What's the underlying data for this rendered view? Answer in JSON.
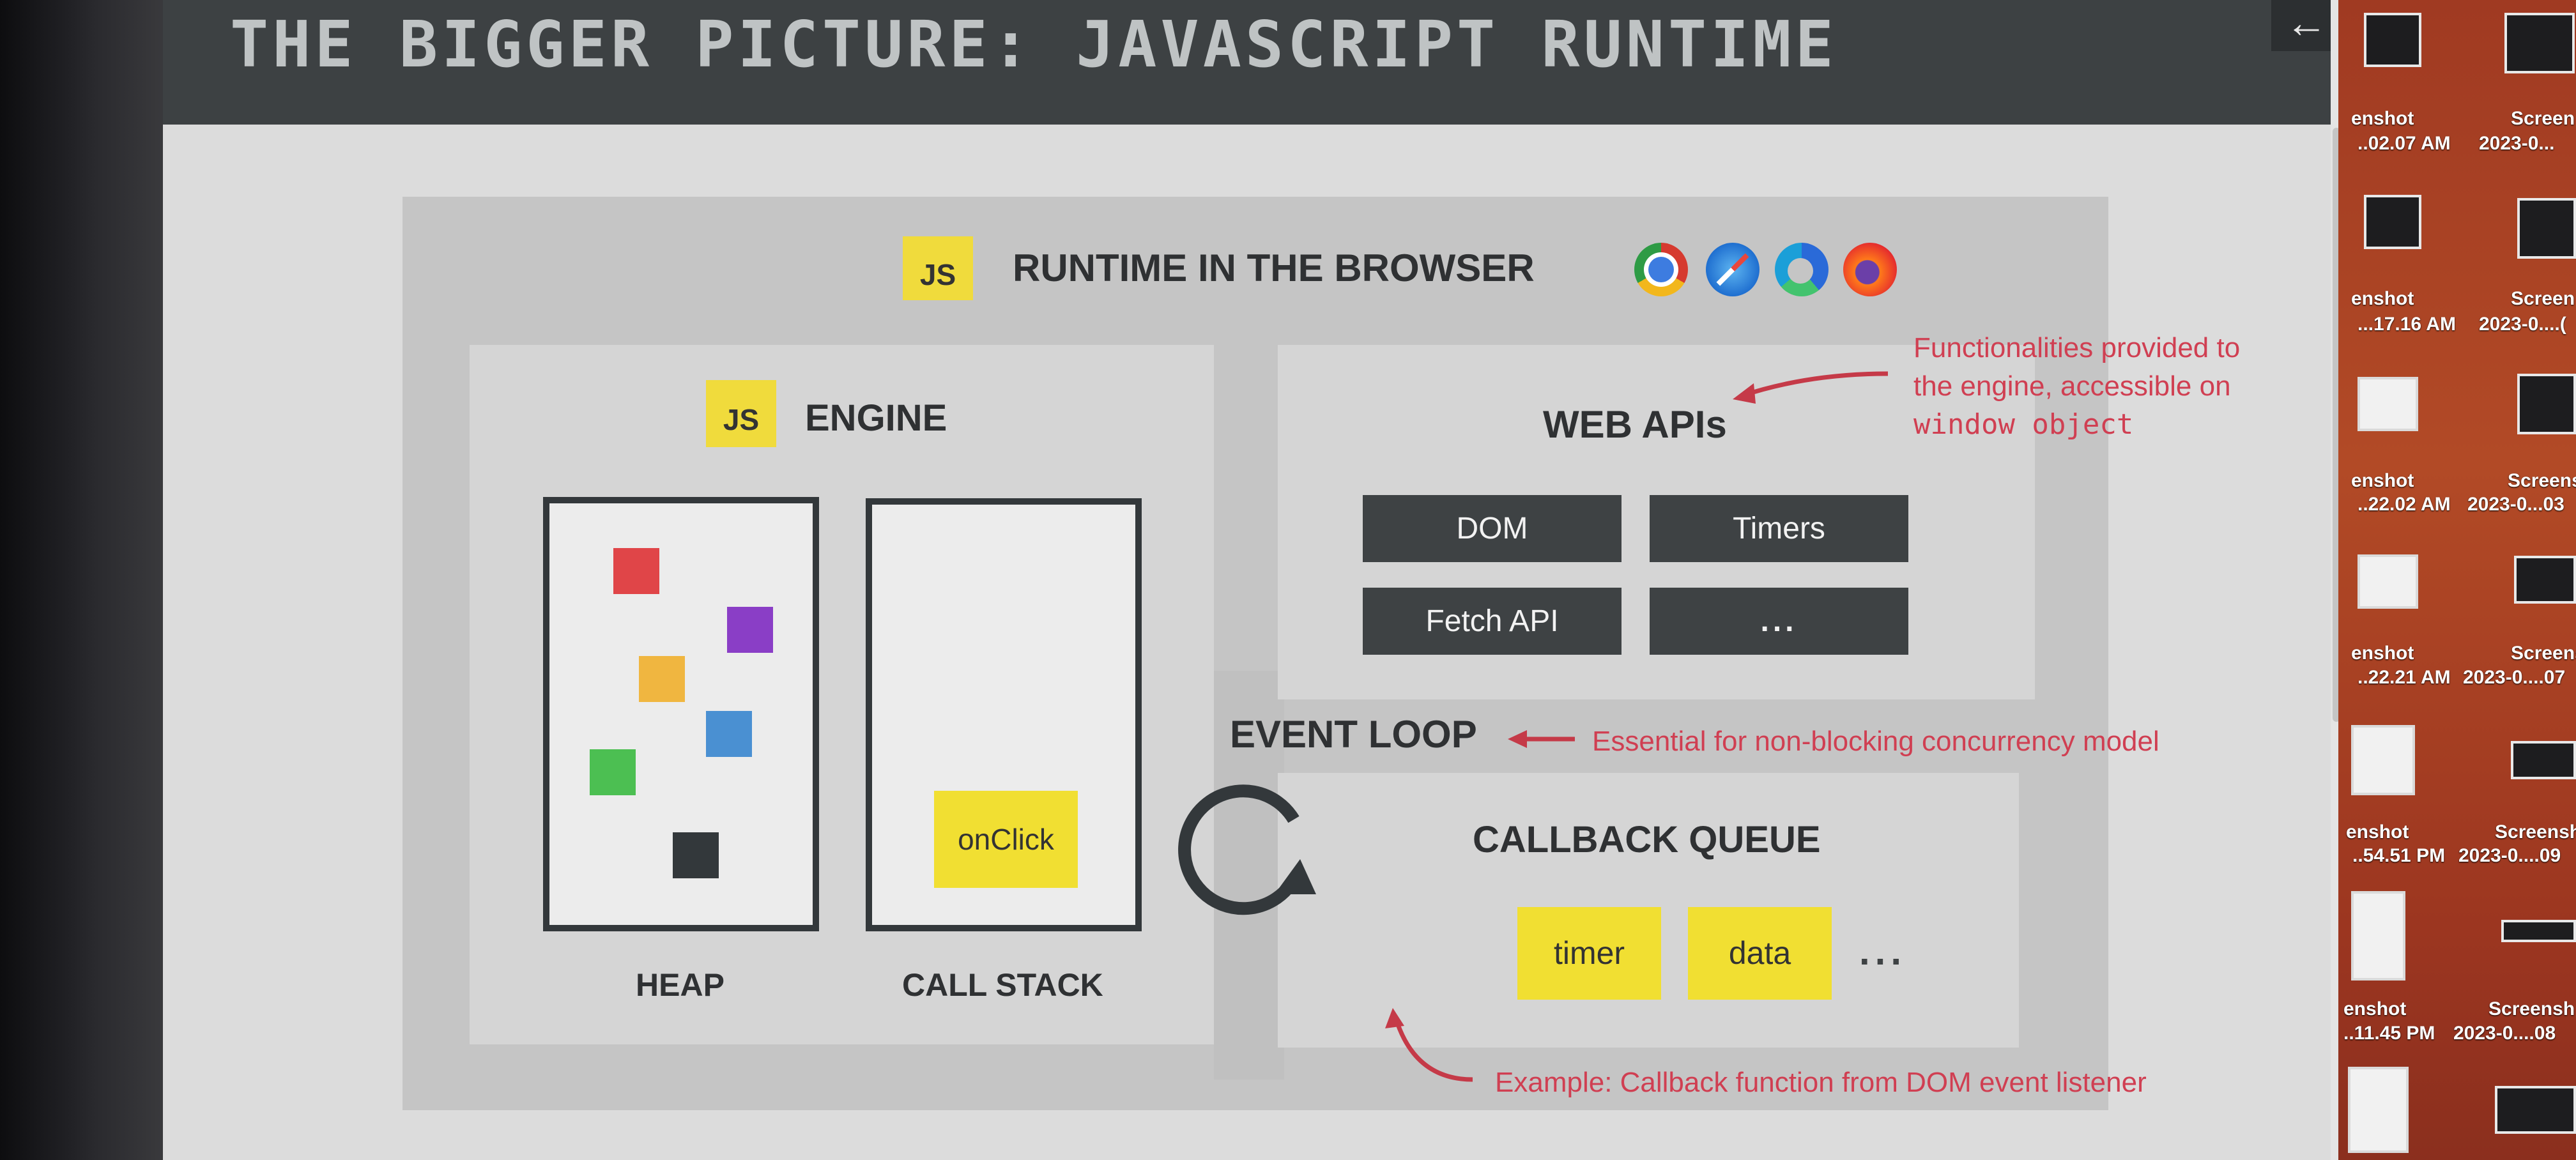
{
  "slide": {
    "title": "THE BIGGER PICTURE: JAVASCRIPT RUNTIME",
    "back_arrow": "←"
  },
  "diagram": {
    "runtime": {
      "badge": "JS",
      "title": "RUNTIME IN THE BROWSER"
    },
    "browser_icons": [
      "chrome-icon",
      "safari-icon",
      "edge-icon",
      "firefox-icon"
    ],
    "engine": {
      "badge": "JS",
      "title": "ENGINE",
      "heap_label": "HEAP",
      "call_stack_label": "CALL STACK",
      "call_stack_frame": "onClick",
      "heap_object_colors": [
        "#e04548",
        "#8a3ec6",
        "#f0b640",
        "#4a90d2",
        "#4cbf52",
        "#33383b"
      ]
    },
    "web_apis": {
      "title": "WEB APIs",
      "items": [
        "DOM",
        "Timers",
        "Fetch API",
        "..."
      ]
    },
    "event_loop": {
      "title": "EVENT LOOP"
    },
    "callback_queue": {
      "title": "CALLBACK QUEUE",
      "items": [
        "timer",
        "data"
      ],
      "more": "..."
    },
    "notes": {
      "web_apis_line1": "Functionalities provided to",
      "web_apis_line2": "the engine, accessible on",
      "web_apis_line3": "window object",
      "event_loop": "Essential for non-blocking concurrency model",
      "callback": "Example: Callback function from DOM event listener"
    },
    "colors": {
      "accent_yellow": "#f1df32",
      "dark": "#3e4244",
      "annotation_red": "#d03f52"
    }
  },
  "desktop": {
    "files": [
      {
        "col1": "enshot",
        "col2": "Screen",
        "col1b": "..02.07 AM",
        "col2b": "2023-0..."
      },
      {
        "col1": "enshot",
        "col2": "Screen",
        "col1b": "...17.16 AM",
        "col2b": "2023-0....("
      },
      {
        "col1": "enshot",
        "col2": "Screens",
        "col1b": "..22.02 AM",
        "col2b": "2023-0...03"
      },
      {
        "col1": "enshot",
        "col2": "Screens",
        "col1b": "..22.21 AM",
        "col2b": "2023-0....07"
      },
      {
        "col1": "enshot",
        "col2": "Screensh",
        "col1b": "..54.51 PM",
        "col2b": "2023-0....09"
      },
      {
        "col1": "enshot",
        "col2": "Screensh",
        "col1b": "..11.45 PM",
        "col2b": "2023-0....08"
      }
    ]
  }
}
